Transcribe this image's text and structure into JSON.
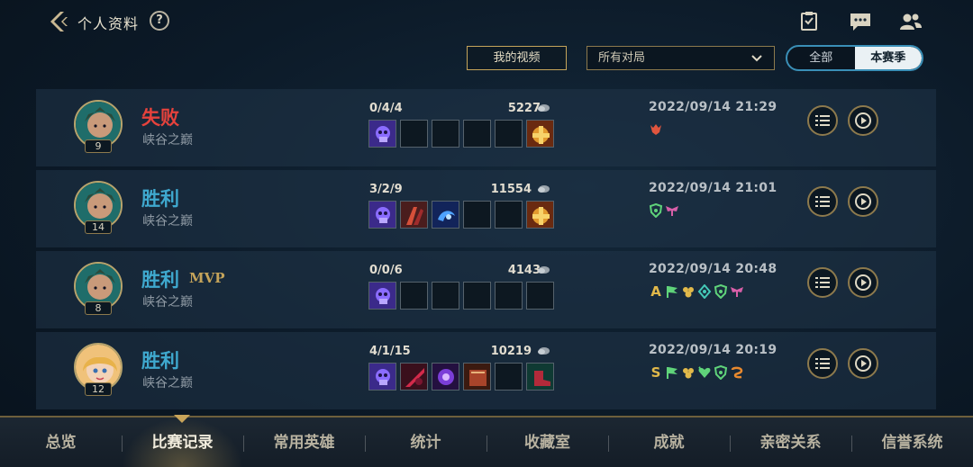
{
  "header": {
    "title": "个人资料",
    "help": "?",
    "icons": [
      "back-chevron-icon",
      "task-list-icon",
      "chat-icon",
      "friends-icon"
    ]
  },
  "filters": {
    "videos_button": "我的视频",
    "match_filter_value": "所有对局",
    "season_toggle": [
      "全部",
      "本赛季"
    ],
    "season_selected": "本赛季"
  },
  "matches": [
    {
      "result": "失败",
      "result_type": "lose",
      "mvp": "",
      "mode": "峡谷之巅",
      "level": "9",
      "kda": "0/4/4",
      "gold": "5227",
      "date": "2022/09/14 21:29",
      "items": [
        "purple-skull-item",
        "",
        "",
        "",
        "",
        "golden-trinket-item"
      ],
      "badges": [
        "red-demon-badge"
      ]
    },
    {
      "result": "胜利",
      "result_type": "win",
      "mvp": "",
      "mode": "峡谷之巅",
      "level": "14",
      "kda": "3/2/9",
      "gold": "11554",
      "date": "2022/09/14 21:01",
      "items": [
        "purple-skull-item",
        "red-claw-item",
        "blue-spirit-item",
        "",
        "",
        "golden-trinket-item"
      ],
      "badges": [
        "green-shield-badge",
        "pink-wings-badge"
      ]
    },
    {
      "result": "胜利",
      "result_type": "win",
      "mvp": "MVP",
      "mode": "峡谷之巅",
      "level": "8",
      "kda": "0/0/6",
      "gold": "4143",
      "date": "2022/09/14 20:48",
      "items": [
        "purple-skull-item",
        "",
        "",
        "",
        "",
        ""
      ],
      "badges": [
        "grade-a-badge",
        "green-flag-badge",
        "gold-cluster-badge",
        "teal-shield-badge",
        "green-shield-badge",
        "pink-wings-badge"
      ]
    },
    {
      "result": "胜利",
      "result_type": "win",
      "mvp": "",
      "mode": "峡谷之巅",
      "level": "12",
      "kda": "4/1/15",
      "gold": "10219",
      "date": "2022/09/14 20:19",
      "items": [
        "purple-skull-item",
        "red-blade-item",
        "purple-orb-item",
        "red-book-item",
        "",
        "red-shoe-trinket-item"
      ],
      "badges": [
        "grade-s-badge",
        "green-flag-badge",
        "gold-cluster-badge",
        "green-heart-badge",
        "green-shield-badge",
        "orange-knot-badge"
      ]
    }
  ],
  "grades": {
    "A": "A",
    "S": "S"
  },
  "bottom_nav": {
    "items": [
      "总览",
      "比赛记录",
      "常用英雄",
      "统计",
      "收藏室",
      "成就",
      "亲密关系",
      "信誉系统"
    ],
    "active": "比赛记录"
  },
  "colors": {
    "gold": "#c5a45a",
    "lose": "#e6423c",
    "win": "#3fa9cf",
    "toggle_border": "#3a8fb7"
  }
}
